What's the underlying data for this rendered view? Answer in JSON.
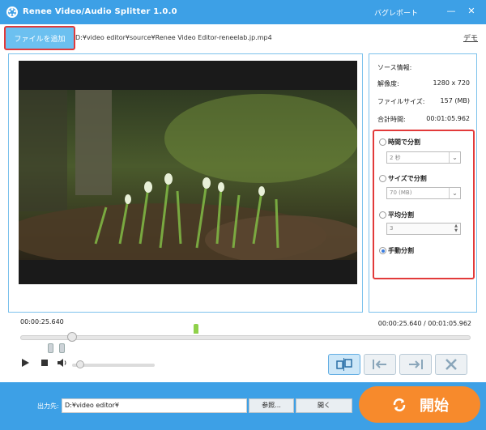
{
  "window": {
    "title": "Renee Video/Audio Splitter 1.0.0",
    "bug_report_label": "バグレポート",
    "minimize": "—",
    "close": "✕"
  },
  "toolbar": {
    "add_file_label": "ファイルを追加",
    "file_path": "D:¥video editor¥source¥Renee Video Editor-reneelab.jp.mp4",
    "demo_label": "デモ"
  },
  "info": {
    "source_info_label": "ソース情報:",
    "resolution_label": "解像度:",
    "resolution_value": "1280 x 720",
    "file_size_label": "ファイルサイズ:",
    "file_size_value": "157 (MB)",
    "total_time_label": "合計時間:",
    "total_time_value": "00:01:05.962"
  },
  "split": {
    "by_time_label": "時間で分割",
    "by_time_value": "2 秒",
    "by_size_label": "サイズで分割",
    "by_size_value": "70 (MB)",
    "average_label": "平均分割",
    "average_value": "3",
    "manual_label": "手動分割",
    "selected": "manual"
  },
  "timeline": {
    "current_time": "00:00:25.640",
    "time_display": "00:00:25.640 / 00:01:05.962",
    "progress_fraction": 0.115
  },
  "footer": {
    "output_label": "出力先:",
    "output_path": "D:¥video editor¥",
    "browse_label": "参照...",
    "open_label": "開く",
    "start_label": "開始"
  },
  "colors": {
    "titlebar": "#3da0e6",
    "accent_orange": "#f78a2c",
    "highlight_red": "#e23a3a"
  }
}
